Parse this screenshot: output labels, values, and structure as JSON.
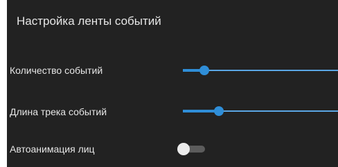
{
  "panel": {
    "title": "Настройка ленты событий"
  },
  "settings": {
    "event_count": {
      "label": "Количество событий",
      "value_fraction": 0.14
    },
    "track_length": {
      "label": "Длина трека событий",
      "value_fraction": 0.23
    },
    "face_autoanimation": {
      "label": "Автоанимация лиц",
      "enabled": false
    }
  },
  "colors": {
    "background": "#222222",
    "text": "#e6e6e6",
    "accent": "#2f8ed8",
    "toggle_off_track": "#5c5c5c",
    "toggle_off_knob": "#ececec"
  }
}
